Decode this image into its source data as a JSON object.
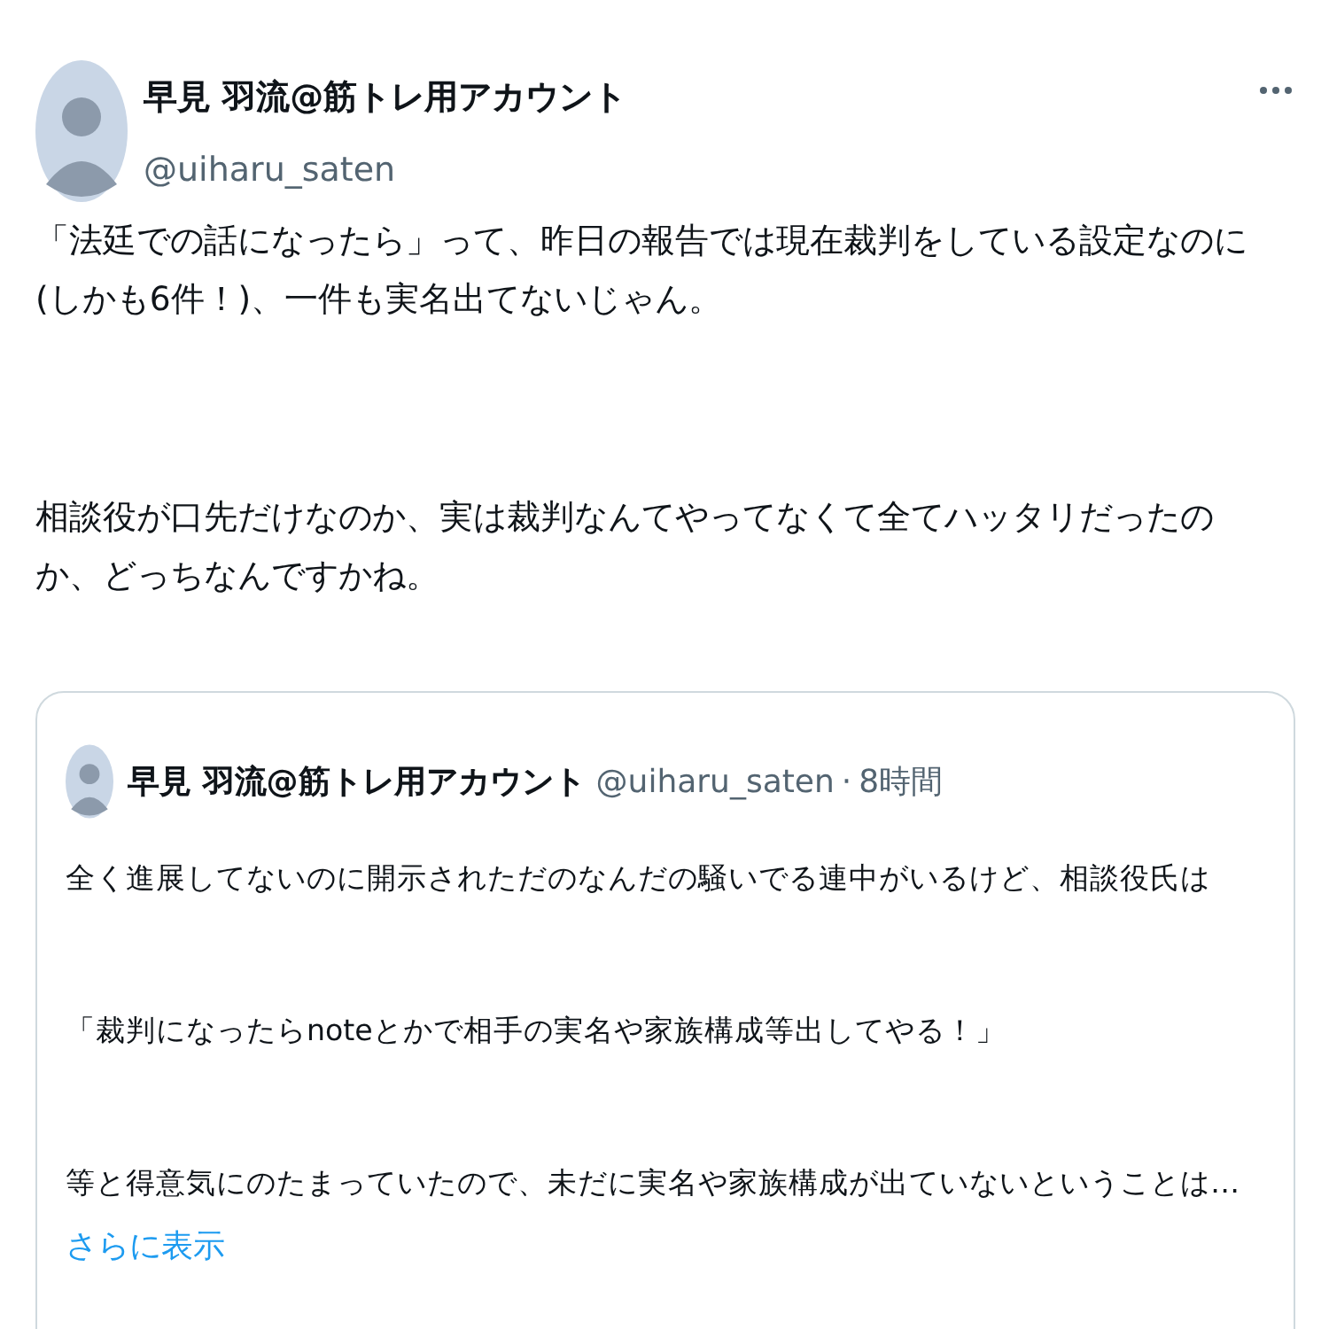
{
  "tweet": {
    "display_name": "早見 羽流@筋トレ用アカウント",
    "handle": "@uiharu_saten",
    "paragraphs": [
      [
        "「法廷での話になったら」って、昨日の報告では現在裁判をしている設定なのに",
        "(しかも6件！)、一件も実名出てないじゃん。"
      ],
      [
        "相談役が口先だけなのか、実は裁判なんてやってなくて全てハッタリだったの",
        "か、どっちなんですかね。"
      ]
    ],
    "quoted_tweet": {
      "display_name": "早見 羽流@筋トレ用アカウント",
      "handle": "@uiharu_saten",
      "separator": "·",
      "time": "8時間",
      "paragraphs": [
        "全く進展してないのに開示されただのなんだの騒いでる連中がいるけど、相談役氏は",
        "「裁判になったらnoteとかで相手の実名や家族構成等出してやる！」",
        "等と得意気にのたまっていたので、未だに実名や家族構成が出ていないということは…"
      ],
      "show_more": "さらに表示"
    }
  }
}
